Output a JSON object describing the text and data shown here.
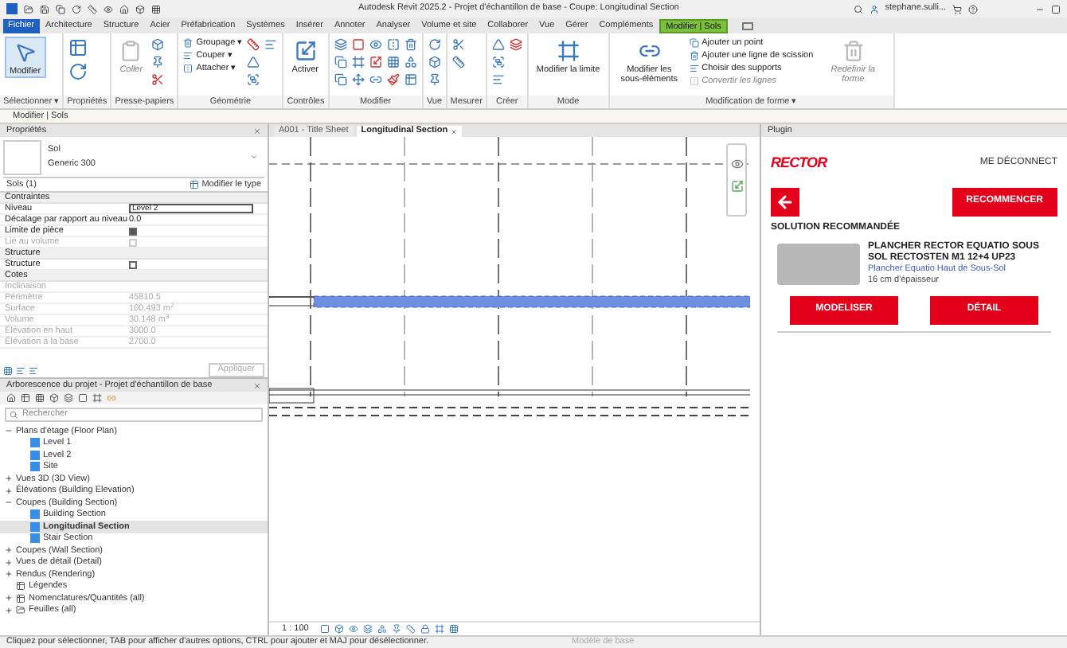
{
  "title_bar": {
    "title": "Autodesk Revit 2025.2 - Projet d'échantillon de base - Coupe: Longitudinal Section",
    "user": "stephane.sulli..."
  },
  "menu_tabs": [
    {
      "label": "Fichier",
      "kind": "file",
      "selected": false
    },
    {
      "label": "Architecture",
      "kind": "tab",
      "selected": false
    },
    {
      "label": "Structure",
      "kind": "tab",
      "selected": false
    },
    {
      "label": "Acier",
      "kind": "tab",
      "selected": false
    },
    {
      "label": "Préfabrication",
      "kind": "tab",
      "selected": false
    },
    {
      "label": "Systèmes",
      "kind": "tab",
      "selected": false
    },
    {
      "label": "Insérer",
      "kind": "tab",
      "selected": false
    },
    {
      "label": "Annoter",
      "kind": "tab",
      "selected": false
    },
    {
      "label": "Analyser",
      "kind": "tab",
      "selected": false
    },
    {
      "label": "Volume et site",
      "kind": "tab",
      "selected": false
    },
    {
      "label": "Collaborer",
      "kind": "tab",
      "selected": false
    },
    {
      "label": "Vue",
      "kind": "tab",
      "selected": false
    },
    {
      "label": "Gérer",
      "kind": "tab",
      "selected": false
    },
    {
      "label": "Compléments",
      "kind": "tab",
      "selected": false
    },
    {
      "label": "Modifier | Sols",
      "kind": "contextual",
      "selected": true
    }
  ],
  "ribbon": [
    {
      "label": "Sélectionner ▾",
      "tools": [
        {
          "kind": "large",
          "label": "Modifier",
          "disabled": false
        }
      ]
    },
    {
      "label": "Propriétés",
      "tools": [
        {
          "kind": "icon"
        },
        {
          "kind": "icon"
        }
      ]
    },
    {
      "label": "Presse-papiers",
      "tools": [
        {
          "kind": "large",
          "label": "Coller",
          "disabled": true
        },
        {
          "kind": "icon"
        },
        {
          "kind": "icon"
        },
        {
          "kind": "icon"
        }
      ]
    },
    {
      "label": "Géométrie",
      "tools": [
        {
          "kind": "small",
          "label": "Groupage ▾",
          "disabled": false
        },
        {
          "kind": "small",
          "label": "Couper ▾",
          "disabled": false
        },
        {
          "kind": "small",
          "label": "Attacher ▾",
          "disabled": false
        },
        {
          "kind": "icon"
        },
        {
          "kind": "icon"
        },
        {
          "kind": "icon"
        },
        {
          "kind": "icon"
        }
      ]
    },
    {
      "label": "Contrôles",
      "tools": [
        {
          "kind": "large",
          "label": "Activer",
          "disabled": false
        }
      ]
    },
    {
      "label": "Modifier",
      "tools": [
        {
          "kind": "icon"
        },
        {
          "kind": "icon"
        },
        {
          "kind": "icon"
        },
        {
          "kind": "icon"
        },
        {
          "kind": "icon"
        },
        {
          "kind": "icon"
        },
        {
          "kind": "icon"
        },
        {
          "kind": "icon"
        },
        {
          "kind": "icon"
        },
        {
          "kind": "icon"
        },
        {
          "kind": "icon"
        },
        {
          "kind": "icon"
        },
        {
          "kind": "icon"
        },
        {
          "kind": "icon"
        },
        {
          "kind": "icon"
        }
      ]
    },
    {
      "label": "Vue",
      "tools": [
        {
          "kind": "icon"
        },
        {
          "kind": "icon"
        },
        {
          "kind": "icon"
        }
      ]
    },
    {
      "label": "Mesurer",
      "tools": [
        {
          "kind": "icon"
        },
        {
          "kind": "icon"
        }
      ]
    },
    {
      "label": "Créer",
      "tools": [
        {
          "kind": "icon"
        },
        {
          "kind": "icon"
        },
        {
          "kind": "icon"
        },
        {
          "kind": "icon"
        }
      ]
    },
    {
      "label": "Mode",
      "tools": [
        {
          "kind": "large",
          "label": "Modifier la limite",
          "disabled": false
        }
      ]
    },
    {
      "label": "Modification de forme ▾",
      "tools": [
        {
          "kind": "large",
          "label": "Modifier les sous-éléments",
          "disabled": false
        },
        {
          "kind": "small",
          "label": "Ajouter un point",
          "disabled": false
        },
        {
          "kind": "small",
          "label": "Ajouter une ligne de scission",
          "disabled": false
        },
        {
          "kind": "small",
          "label": "Choisir des supports",
          "disabled": false
        },
        {
          "kind": "small",
          "label": "Convertir les lignes",
          "disabled": true
        },
        {
          "kind": "large",
          "label": "Redéfinir la forme",
          "disabled": true
        }
      ]
    }
  ],
  "context_bar": "Modifier | Sols",
  "properties": {
    "title": "Propriétés",
    "type_family": "Sol",
    "type_name": "Generic 300",
    "selector": "Sols (1)",
    "edit_type": "Modifier le type",
    "apply": "Appliquer",
    "rows": [
      {
        "kind": "section",
        "label": "Contraintes"
      },
      {
        "kind": "field",
        "label": "Niveau",
        "value": "Level 2",
        "disabled": false
      },
      {
        "kind": "text",
        "label": "Décalage par rapport au niveau",
        "value": "0.0",
        "disabled": false
      },
      {
        "kind": "checkbox",
        "label": "Limite de pièce",
        "checked": true,
        "disabled": false
      },
      {
        "kind": "checkbox",
        "label": "Lié au volume",
        "checked": false,
        "disabled": true
      },
      {
        "kind": "section",
        "label": "Structure"
      },
      {
        "kind": "checkbox",
        "label": "Structure",
        "checked": false,
        "disabled": false
      },
      {
        "kind": "section",
        "label": "Cotes"
      },
      {
        "kind": "text",
        "label": "Inclinaison",
        "disabled": true
      },
      {
        "kind": "text",
        "label": "Périmètre",
        "value": "45810.5",
        "disabled": true
      },
      {
        "kind": "text",
        "label": "Surface",
        "value": "100.493 m$^{2}$",
        "disabled": true
      },
      {
        "kind": "text",
        "label": "Volume",
        "value": "30.148 m$^{3}$",
        "disabled": true
      },
      {
        "kind": "text",
        "label": "Élévation en haut",
        "value": "3000.0",
        "disabled": true
      },
      {
        "kind": "text",
        "label": "Élévation à la base",
        "value": "2700.0",
        "disabled": true
      }
    ]
  },
  "project_browser": {
    "title": "Arborescence du projet - Projet d'échantillon de base",
    "search_placeholder": "Rechercher",
    "tree": [
      {
        "label": "Plans d'étage (Floor Plan)",
        "kind": "folder",
        "expanded": true,
        "selected": false,
        "children": [
          {
            "label": "Level 1",
            "kind": "view",
            "selected": false
          },
          {
            "label": "Level 2",
            "kind": "view",
            "selected": false
          },
          {
            "label": "Site",
            "kind": "view",
            "selected": false
          }
        ]
      },
      {
        "label": "Vues 3D (3D View)",
        "kind": "folder",
        "expanded": false,
        "selected": false
      },
      {
        "label": "Élévations (Building Elevation)",
        "kind": "folder",
        "expanded": false,
        "selected": false
      },
      {
        "label": "Coupes (Building Section)",
        "kind": "folder",
        "expanded": true,
        "selected": false,
        "children": [
          {
            "label": "Building Section",
            "kind": "view",
            "selected": false
          },
          {
            "label": "Longitudinal Section",
            "kind": "view",
            "selected": true
          },
          {
            "label": "Stair Section",
            "kind": "view",
            "selected": false
          }
        ]
      },
      {
        "label": "Coupes (Wall Section)",
        "kind": "folder",
        "expanded": false,
        "selected": false
      },
      {
        "label": "Vues de détail (Detail)",
        "kind": "folder",
        "expanded": false,
        "selected": false
      },
      {
        "label": "Rendus (Rendering)",
        "kind": "folder",
        "expanded": false,
        "selected": false
      },
      {
        "label": "Légendes",
        "kind": "legend",
        "selected": false
      },
      {
        "label": "Nomenclatures/Quantités (all)",
        "kind": "schedule",
        "expanded": false,
        "selected": false
      },
      {
        "label": "Feuilles (all)",
        "kind": "sheet",
        "expanded": false,
        "selected": false
      }
    ]
  },
  "view": {
    "tabs": [
      {
        "label": "A001 - Title Sheet",
        "selected": false
      },
      {
        "label": "Longitudinal Section",
        "selected": true
      }
    ],
    "scale": "1 : 100"
  },
  "plugin": {
    "title": "Plugin",
    "logo": "RECTOR",
    "logout": "ME DÉCONNECT",
    "restart": "RECOMMENCER",
    "heading": "SOLUTION RECOMMANDÉE",
    "product": "PLANCHER RECTOR EQUATIO SOUS SOL RECTOSTEN M1 12+4 UP23",
    "subtitle": "Plancher Equatio Haut de Sous-Sol",
    "thickness": "16 cm d'épaisseur",
    "buttons": [
      "MODELISER",
      "DÉTAIL"
    ]
  },
  "status_bar": {
    "message": "Cliquez pour sélectionner, TAB pour afficher d'autres options, CTRL pour ajouter et MAJ pour désélectionner.",
    "model": "Modèle de base"
  }
}
